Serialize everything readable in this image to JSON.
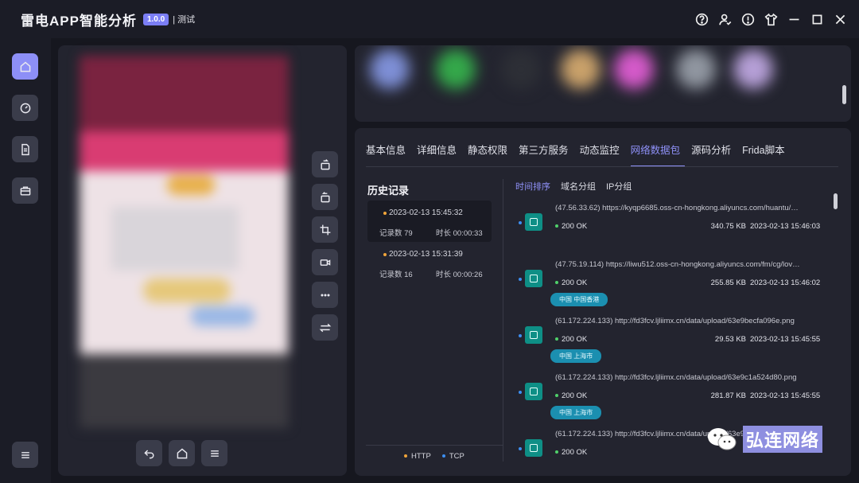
{
  "app": {
    "title": "雷电APP智能分析",
    "version": "1.0.0",
    "label": "| 测试"
  },
  "tabs": [
    "基本信息",
    "详细信息",
    "静态权限",
    "第三方服务",
    "动态监控",
    "网络数据包",
    "源码分析",
    "Frida脚本"
  ],
  "active_tab": "网络数据包",
  "history": {
    "title": "历史记录",
    "records": [
      {
        "time": "2023-02-13 15:45:32",
        "count": "记录数 79",
        "duration": "时长 00:00:33"
      },
      {
        "time": "2023-02-13 15:31:39",
        "count": "记录数 16",
        "duration": "时长 00:00:26"
      }
    ],
    "legend": {
      "http": "HTTP",
      "tcp": "TCP"
    }
  },
  "subtabs": [
    "时间排序",
    "域名分组",
    "IP分组"
  ],
  "requests": [
    {
      "url": "(47.56.33.62)  https://kyqp6685.oss-cn-hongkong.aliyuncs.com/huantu/…",
      "status": "200 OK",
      "size": "340.75 KB",
      "time": "2023-02-13 15:46:03",
      "tag": ""
    },
    {
      "url": "(47.75.19.114)  https://liwu512.oss-cn-hongkong.aliyuncs.com/fm/cg/lov…",
      "status": "200 OK",
      "size": "255.85 KB",
      "time": "2023-02-13 15:46:02",
      "tag": "中国 中国香港"
    },
    {
      "url": "(61.172.224.133)  http://fd3fcv.ljliimx.cn/data/upload/63e9becfa096e.png",
      "status": "200 OK",
      "size": "29.53 KB",
      "time": "2023-02-13 15:45:55",
      "tag": "中国 上海市"
    },
    {
      "url": "(61.172.224.133)  http://fd3fcv.ljliimx.cn/data/upload/63e9c1a524d80.png",
      "status": "200 OK",
      "size": "281.87 KB",
      "time": "2023-02-13 15:45:55",
      "tag": "中国 上海市"
    },
    {
      "url": "(61.172.224.133)  http://fd3fcv.ljliimx.cn/data/upload/63e9c3cfc058a.png",
      "status": "200 OK",
      "size": "",
      "time": "",
      "tag": ""
    }
  ],
  "watermark": "弘连网络",
  "colors": {
    "accent": "#8f91f8",
    "http_dot": "#f1a53a",
    "tcp_dot": "#3c8ef0",
    "tag": "#1b8fb0",
    "icon_bg": "#0e8f86"
  }
}
